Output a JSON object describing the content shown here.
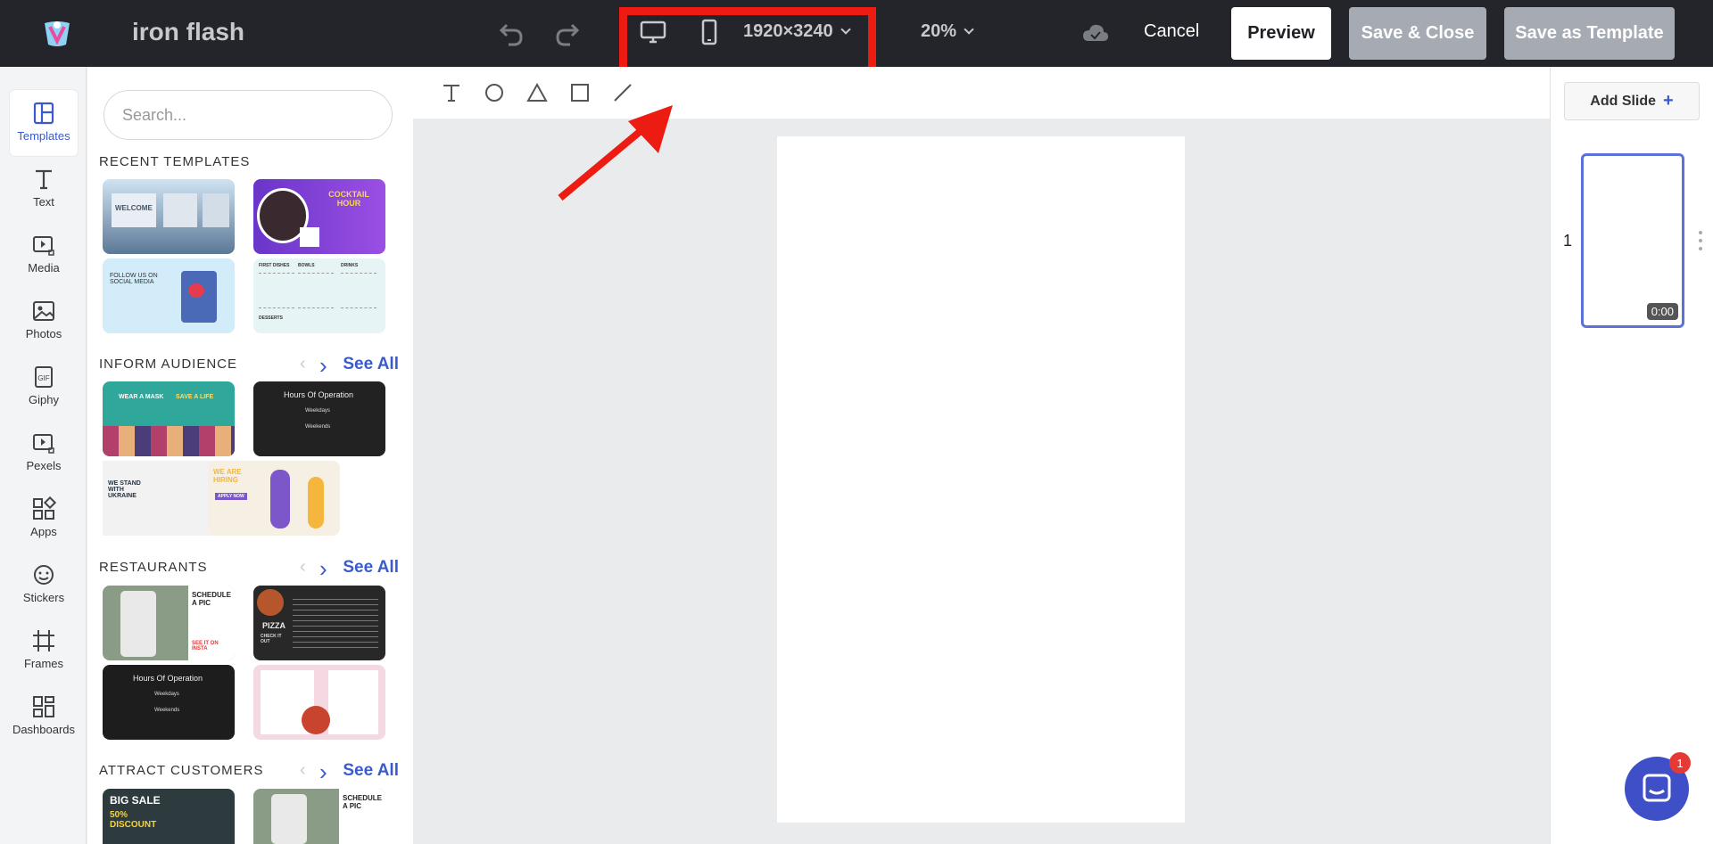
{
  "header": {
    "app_title": "iron flash",
    "resolution": "1920×3240",
    "zoom": "20%",
    "cancel_label": "Cancel",
    "preview_label": "Preview",
    "save_close_label": "Save & Close",
    "save_template_label": "Save as Template",
    "highlight_color": "#ec1c13"
  },
  "rail": [
    {
      "label": "Templates",
      "icon": "templates-icon",
      "active": true
    },
    {
      "label": "Text",
      "icon": "text-icon"
    },
    {
      "label": "Media",
      "icon": "media-icon"
    },
    {
      "label": "Photos",
      "icon": "photos-icon"
    },
    {
      "label": "Giphy",
      "icon": "gif-icon"
    },
    {
      "label": "Pexels",
      "icon": "pexels-icon"
    },
    {
      "label": "Apps",
      "icon": "apps-icon"
    },
    {
      "label": "Stickers",
      "icon": "stickers-icon"
    },
    {
      "label": "Frames",
      "icon": "frames-icon"
    },
    {
      "label": "Dashboards",
      "icon": "dashboards-icon"
    }
  ],
  "panel": {
    "search_placeholder": "Search...",
    "see_all": "See All",
    "sections": [
      "RECENT TEMPLATES",
      "INFORM AUDIENCE",
      "RESTAURANTS",
      "ATTRACT CUSTOMERS"
    ],
    "thumb_texts": {
      "welcome": "WELCOME",
      "cocktail": "COCKTAIL HOUR",
      "social": "FOLLOW US ON SOCIAL MEDIA",
      "menu_first": "FIRST DISHES",
      "menu_bowls": "BOWLS",
      "menu_drinks": "DRINKS",
      "menu_desserts": "DESSERTS",
      "mask": "WEAR A MASK",
      "save_life": "SAVE A LIFE",
      "hours": "Hours Of Operation",
      "weekdays": "Weekdays",
      "weekends": "Weekends",
      "ukraine": "WE STAND WITH UKRAINE",
      "hiring": "WE ARE HIRING",
      "apply": "APPLY NOW",
      "schedule": "SCHEDULE A PIC",
      "insta": "SEE IT ON INSTA",
      "pizza": "PIZZA",
      "check": "CHECK IT OUT",
      "big_sale": "BIG SALE",
      "discount": "50% DISCOUNT"
    }
  },
  "right": {
    "add_slide": "Add Slide",
    "slide_number": "1",
    "slide_time": "0:00"
  },
  "chat": {
    "badge": "1"
  }
}
